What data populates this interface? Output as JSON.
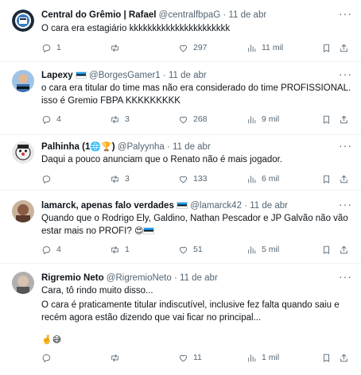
{
  "tweets": [
    {
      "name": "Central do Grêmio | Rafael",
      "handle": "@centralfbpaG",
      "dot": "·",
      "date": "11 de abr",
      "lines": [
        "O cara era estagiário kkkkkkkkkkkkkkkkkkkkkk"
      ],
      "replies": "1",
      "retweets": "",
      "likes": "297",
      "views": "11 mil",
      "avatar_color": "#1b2a3a"
    },
    {
      "name": "Lapexy",
      "handle": "@BorgesGamer1",
      "dot": "·",
      "date": "11 de abr",
      "lines": [
        "o cara era titular do time mas não era considerado do time PROFISSIONAL.",
        "isso é Gremio FBPA KKKKKKKKK"
      ],
      "replies": "4",
      "retweets": "3",
      "likes": "268",
      "views": "9 mil",
      "avatar_color": "#3a6ea5"
    },
    {
      "name": "Palhinha (1",
      "name_suffix": ")",
      "handle": "@Palyynha",
      "dot": "·",
      "date": "11 de abr",
      "lines": [
        "Daqui a pouco anunciam que o Renato não é mais jogador."
      ],
      "replies": "",
      "retweets": "3",
      "likes": "133",
      "views": "6 mil",
      "avatar_color": "#4a4a4a"
    },
    {
      "name": "lamarck, apenas falo verdades",
      "handle": "@lamarck42",
      "dot": "·",
      "date": "11 de abr",
      "lines": [
        "Quando que o Rodrigo Ely, Galdino, Nathan Pescador e JP Galvão não vão",
        "estar mais no PROFI?"
      ],
      "replies": "4",
      "retweets": "1",
      "likes": "51",
      "views": "5 mil",
      "avatar_color": "#8a5a44"
    },
    {
      "name": "Rigremio Neto",
      "handle": "@RigremioNeto",
      "dot": "·",
      "date": "11 de abr",
      "lines": [
        "Cara, tô rindo muito disso...",
        "O cara é praticamente titular indiscutível, inclusive fez falta quando saiu e",
        "recém agora estão dizendo que vai ficar no principal..."
      ],
      "replies": "",
      "retweets": "",
      "likes": "11",
      "views": "1 mil",
      "avatar_color": "#8c8c8c"
    }
  ],
  "icons": {
    "reply": "reply-icon",
    "retweet": "retweet-icon",
    "like": "heart-icon",
    "views": "views-icon",
    "bookmark": "bookmark-icon",
    "share": "share-icon",
    "more": "more-icon"
  },
  "colors": {
    "text": "#0f1419",
    "muted": "#536471",
    "divider": "#eff3f4"
  }
}
